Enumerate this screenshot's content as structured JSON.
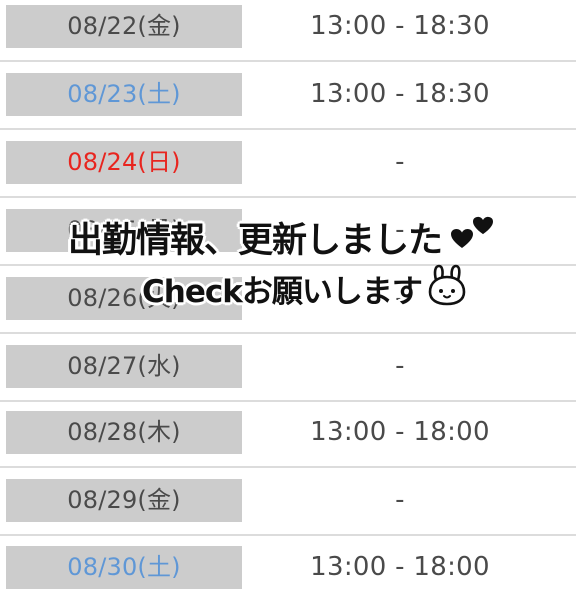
{
  "schedule": {
    "rows": [
      {
        "date": "08/22(金)",
        "day_type": "weekday",
        "hours": "13:00 - 18:30"
      },
      {
        "date": "08/23(土)",
        "day_type": "saturday",
        "hours": "13:00 - 18:30"
      },
      {
        "date": "08/24(日)",
        "day_type": "sunday",
        "hours": "-"
      },
      {
        "date": "08/25(月)",
        "day_type": "weekday",
        "hours": "-"
      },
      {
        "date": "08/26(火)",
        "day_type": "weekday",
        "hours": "-"
      },
      {
        "date": "08/27(水)",
        "day_type": "weekday",
        "hours": "-"
      },
      {
        "date": "08/28(木)",
        "day_type": "weekday",
        "hours": "13:00 - 18:00"
      },
      {
        "date": "08/29(金)",
        "day_type": "weekday",
        "hours": "-"
      },
      {
        "date": "08/30(土)",
        "day_type": "saturday",
        "hours": "13:00 - 18:00"
      }
    ]
  },
  "overlay": {
    "line1": "出勤情報、更新しました",
    "line2": "Checkお願いします"
  },
  "colors": {
    "date_cell_bg": "#cccccc",
    "weekday_text": "#4a4a4a",
    "saturday_text": "#5f97d6",
    "sunday_text": "#e8251f",
    "divider": "#dcdcdc"
  },
  "icons": {
    "hearts": "heart-icon",
    "bunny": "bunny-face-icon"
  }
}
